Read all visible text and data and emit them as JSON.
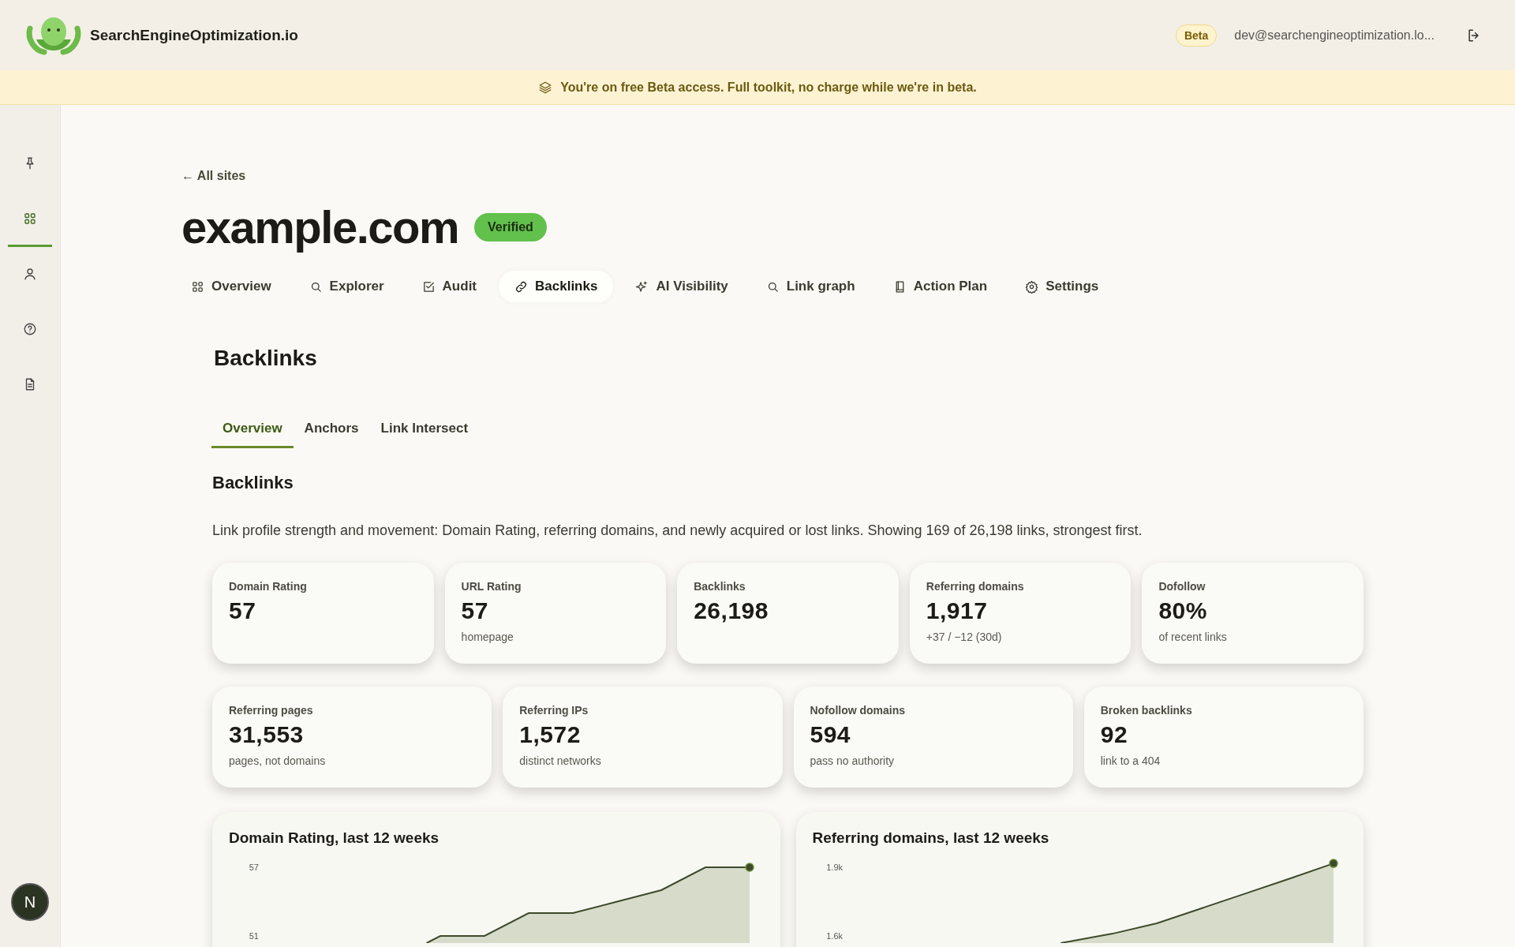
{
  "header": {
    "brand": "SearchEngineOptimization.io",
    "beta_badge": "Beta",
    "email": "dev@searchengineoptimization.lo..."
  },
  "banner": {
    "text": "You're on free Beta access. Full toolkit, no charge while we're in beta."
  },
  "sidebar": {
    "items": [
      {
        "selected": false
      },
      {
        "selected": true
      },
      {
        "selected": false
      },
      {
        "selected": false
      },
      {
        "selected": false
      }
    ],
    "avatar": "N"
  },
  "back_link": "← All sites",
  "site": {
    "name": "example.com",
    "badge": "Verified"
  },
  "nav_tabs": [
    {
      "label": "Overview",
      "selected": false
    },
    {
      "label": "Explorer",
      "selected": false
    },
    {
      "label": "Audit",
      "selected": false
    },
    {
      "label": "Backlinks",
      "selected": true
    },
    {
      "label": "AI Visibility",
      "selected": false
    },
    {
      "label": "Link graph",
      "selected": false
    },
    {
      "label": "Action Plan",
      "selected": false
    },
    {
      "label": "Settings",
      "selected": false
    }
  ],
  "section_title": "Backlinks",
  "sub_tabs": [
    {
      "label": "Overview",
      "selected": true
    },
    {
      "label": "Anchors",
      "selected": false
    },
    {
      "label": "Link Intersect",
      "selected": false
    }
  ],
  "panel": {
    "title": "Backlinks",
    "description": "Link profile strength and movement: Domain Rating, referring domains, and newly acquired or lost links. Showing 169 of 26,198 links, strongest first."
  },
  "metrics_rows": [
    [
      {
        "label": "Domain Rating",
        "value": "57"
      },
      {
        "label": "URL Rating",
        "value": "57",
        "note": "homepage"
      },
      {
        "label": "Backlinks",
        "value": "26,198"
      },
      {
        "label": "Referring domains",
        "value": "1,917",
        "note": "+37 / −12 (30d)"
      },
      {
        "label": "Dofollow",
        "value": "80%",
        "note": "of recent links"
      }
    ],
    [
      {
        "label": "Referring pages",
        "value": "31,553",
        "note": "pages, not domains"
      },
      {
        "label": "Referring IPs",
        "value": "1,572",
        "note": "distinct networks"
      },
      {
        "label": "Nofollow domains",
        "value": "594",
        "note": "pass no authority"
      },
      {
        "label": "Broken backlinks",
        "value": "92",
        "note": "link to a 404"
      }
    ]
  ],
  "charts": [
    {
      "title": "Domain Rating, last 12 weeks",
      "y_axis_labels": [
        "57",
        "51"
      ]
    },
    {
      "title": "Referring domains, last 12 weeks",
      "y_axis_labels": [
        "1.9k",
        "1.6k"
      ]
    }
  ]
}
